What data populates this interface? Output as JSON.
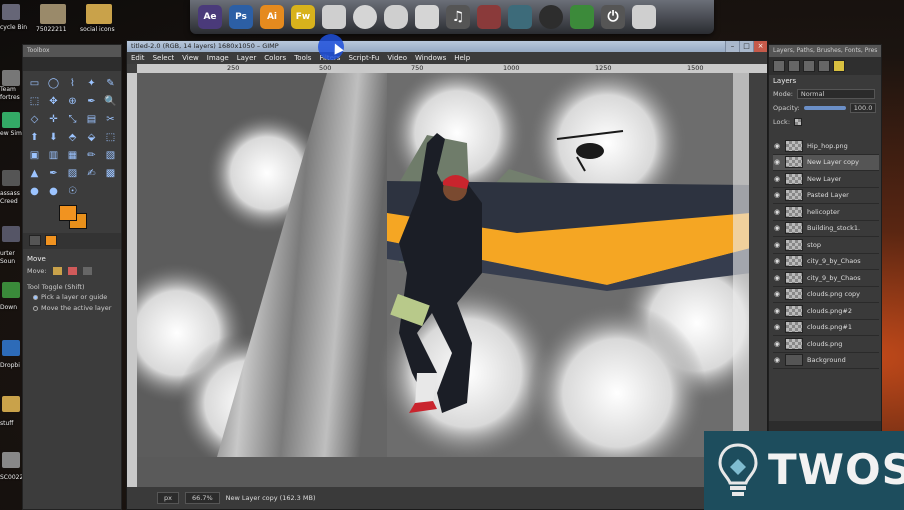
{
  "desktop": {
    "labels": [
      "cycle Bin",
      "75022211",
      "social icons",
      "Team",
      "fortres",
      "ew Sim",
      "assass",
      "Creed",
      "urter",
      "Soun",
      "Down",
      "Dropbi",
      "stuff",
      "SC0022"
    ]
  },
  "dock": {
    "items": [
      {
        "icon": "after-effects-icon",
        "label": "Ae",
        "color": "#4a3a7a"
      },
      {
        "icon": "photoshop-icon",
        "label": "Ps",
        "color": "#2c5fa5"
      },
      {
        "icon": "illustrator-icon",
        "label": "Ai",
        "color": "#e58a1e"
      },
      {
        "icon": "fireworks-icon",
        "label": "Fw",
        "color": "#d8b21c"
      },
      {
        "icon": "bird-icon",
        "label": "",
        "color": "#cfcfcf"
      },
      {
        "icon": "firefox-icon",
        "label": "",
        "color": "#d5d5d5"
      },
      {
        "icon": "rock-icon",
        "label": "",
        "color": "#cfcfcf"
      },
      {
        "icon": "clapper-icon",
        "label": "",
        "color": "#d5d5d5"
      },
      {
        "icon": "music-note-icon",
        "label": "♫",
        "color": "#555"
      },
      {
        "icon": "game-icon",
        "label": "",
        "color": "#8a3a3a"
      },
      {
        "icon": "game2-icon",
        "label": "",
        "color": "#3d6b7a"
      },
      {
        "icon": "counter-strike-icon",
        "label": "",
        "color": "#2d2d2d"
      },
      {
        "icon": "sims-icon",
        "label": "",
        "color": "#3c8a3a"
      },
      {
        "icon": "power-icon",
        "label": "⏻",
        "color": "#555"
      },
      {
        "icon": "trash-icon",
        "label": "",
        "color": "#cfcfcf"
      }
    ]
  },
  "toolbox": {
    "title": "Toolbox",
    "tools": [
      "▭",
      "◯",
      "⌇",
      "✦",
      "✎",
      "⬚",
      "✥",
      "⊕",
      "✒",
      "🔍",
      "◇",
      "✛",
      "⤡",
      "▤",
      "✂",
      "⬆",
      "⬇",
      "⬘",
      "⬙",
      "⬚",
      "▣",
      "▥",
      "▦",
      "✏",
      "▧",
      "▲",
      "✒",
      "▨",
      "✍",
      "▩",
      "●",
      "●",
      "☉",
      "",
      "",
      "",
      "",
      "",
      "",
      ""
    ],
    "options": {
      "title": "Move",
      "move_label": "Move:",
      "tool_toggle": "Tool Toggle  (Shift)",
      "option1": "Pick a layer or guide",
      "option2": "Move the active layer"
    }
  },
  "gimp": {
    "title": "titled-2.0 (RGB, 14 layers) 1680x1050 – GIMP",
    "menus": [
      "Edit",
      "Select",
      "View",
      "Image",
      "Layer",
      "Colors",
      "Tools",
      "Filters",
      "Script-Fu",
      "Video",
      "Windows",
      "Help"
    ],
    "ruler_marks": [
      "250",
      "500",
      "750",
      "1000",
      "1250",
      "1500"
    ],
    "status": {
      "unit": "px",
      "zoom": "66.7%",
      "message": "New Layer copy (162.3 MB)"
    }
  },
  "layers_panel": {
    "title": "Layers, Paths, Brushes, Fonts, Pres",
    "heading": "Layers",
    "mode_label": "Mode:",
    "mode_value": "Normal",
    "opacity_label": "Opacity:",
    "opacity_value": "100.0",
    "lock_label": "Lock:",
    "items": [
      {
        "name": "Hip_hop.png",
        "active": false,
        "eye": true
      },
      {
        "name": "New Layer copy",
        "active": true,
        "eye": true
      },
      {
        "name": "New Layer",
        "active": false,
        "eye": true
      },
      {
        "name": "Pasted Layer",
        "active": false,
        "eye": true
      },
      {
        "name": "helicopter",
        "active": false,
        "eye": true
      },
      {
        "name": "Building_stock1.",
        "active": false,
        "eye": true
      },
      {
        "name": "stop",
        "active": false,
        "eye": true
      },
      {
        "name": "city_9_by_Chaos",
        "active": false,
        "eye": true
      },
      {
        "name": "city_9_by_Chaos",
        "active": false,
        "eye": true
      },
      {
        "name": "clouds.png copy",
        "active": false,
        "eye": true
      },
      {
        "name": "clouds.png#2",
        "active": false,
        "eye": true
      },
      {
        "name": "clouds.png#1",
        "active": false,
        "eye": true
      },
      {
        "name": "clouds.png",
        "active": false,
        "eye": true
      },
      {
        "name": "Background",
        "active": false,
        "eye": true
      }
    ]
  },
  "watermark": {
    "text": "TWOS",
    "bg": "#1d4d5d"
  },
  "colors": {
    "foreground": "#f19320",
    "accent_stripe": "#f5a623"
  }
}
